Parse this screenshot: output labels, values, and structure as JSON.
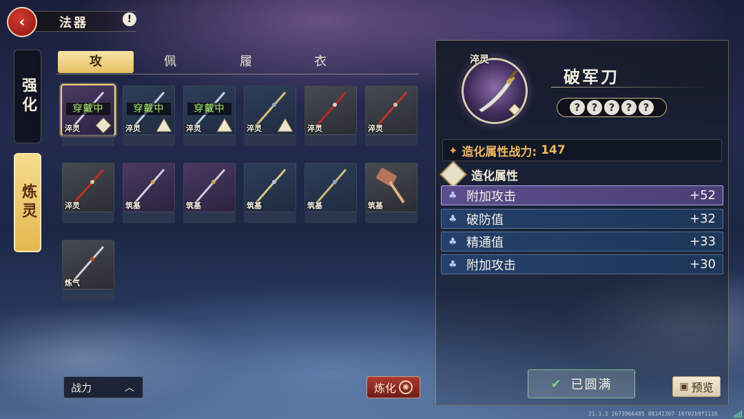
{
  "header": {
    "title": "法器",
    "back_icon": "back-icon",
    "alert_icon": "!"
  },
  "side_tabs": [
    {
      "label": "强化",
      "active": false
    },
    {
      "label": "炼灵",
      "active": true
    }
  ],
  "category_tabs": [
    {
      "label": "攻",
      "active": true
    },
    {
      "label": "佩",
      "active": false
    },
    {
      "label": "履",
      "active": false
    },
    {
      "label": "衣",
      "active": false
    }
  ],
  "items": [
    {
      "grade": "淬灵",
      "equipped_label": "穿戴中",
      "bg": "purple",
      "selected": true,
      "mark": "diamond"
    },
    {
      "grade": "淬灵",
      "equipped_label": "穿戴中",
      "bg": "blue",
      "selected": false,
      "mark": "triangle"
    },
    {
      "grade": "淬灵",
      "equipped_label": "穿戴中",
      "bg": "blue",
      "selected": false,
      "mark": "triangle"
    },
    {
      "grade": "淬灵",
      "equipped_label": "",
      "bg": "blue",
      "selected": false,
      "mark": "triangle"
    },
    {
      "grade": "淬灵",
      "equipped_label": "",
      "bg": "gray",
      "selected": false,
      "mark": ""
    },
    {
      "grade": "淬灵",
      "equipped_label": "",
      "bg": "gray",
      "selected": false,
      "mark": ""
    },
    {
      "grade": "淬灵",
      "equipped_label": "",
      "bg": "gray",
      "selected": false,
      "mark": ""
    },
    {
      "grade": "筑基",
      "equipped_label": "",
      "bg": "purple",
      "selected": false,
      "mark": ""
    },
    {
      "grade": "筑基",
      "equipped_label": "",
      "bg": "purple",
      "selected": false,
      "mark": ""
    },
    {
      "grade": "筑基",
      "equipped_label": "",
      "bg": "blue",
      "selected": false,
      "mark": ""
    },
    {
      "grade": "筑基",
      "equipped_label": "",
      "bg": "blue",
      "selected": false,
      "mark": ""
    },
    {
      "grade": "筑基",
      "equipped_label": "",
      "bg": "gray",
      "selected": false,
      "mark": ""
    },
    {
      "grade": "炼气",
      "equipped_label": "",
      "bg": "gray",
      "selected": false,
      "mark": ""
    }
  ],
  "controls": {
    "sort_label": "战力",
    "smelt_label": "炼化"
  },
  "detail": {
    "grade": "淬灵",
    "name": "破军刀",
    "slots": [
      "?",
      "?",
      "?",
      "?",
      "?"
    ],
    "power_label": "造化属性战力:",
    "power_value": "147",
    "attr_header": "造化属性",
    "attributes": [
      {
        "name": "附加攻击",
        "value": "+52",
        "highlight": true
      },
      {
        "name": "破防值",
        "value": "+32",
        "highlight": false
      },
      {
        "name": "精通值",
        "value": "+33",
        "highlight": false
      },
      {
        "name": "附加攻击",
        "value": "+30",
        "highlight": false
      }
    ],
    "maxed_label": "已圆满",
    "preview_label": "预览"
  },
  "footer": "21.1.1 2673966485 08141307 16f02b9f1116"
}
